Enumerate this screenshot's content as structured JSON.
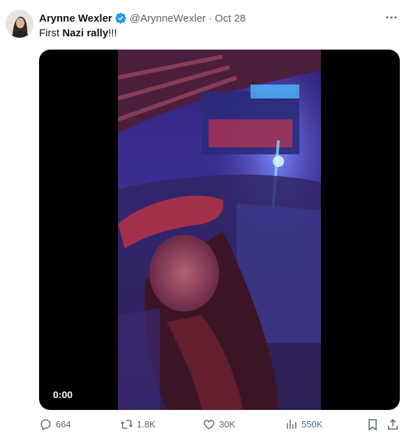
{
  "author": {
    "name": "Arynne Wexler",
    "handle": "@ArynneWexler",
    "separator": "·",
    "time": "Oct 28"
  },
  "tweet": {
    "text_prefix": "First ",
    "text_bold": "Nazi rally",
    "text_suffix": "!!!"
  },
  "media": {
    "duration": "0:00"
  },
  "actions": {
    "replies": "664",
    "reposts": "1.8K",
    "likes": "30K",
    "views": "550K"
  },
  "colors": {
    "verified": "#1d9bf0",
    "muted": "#536471",
    "text": "#0f1419"
  }
}
